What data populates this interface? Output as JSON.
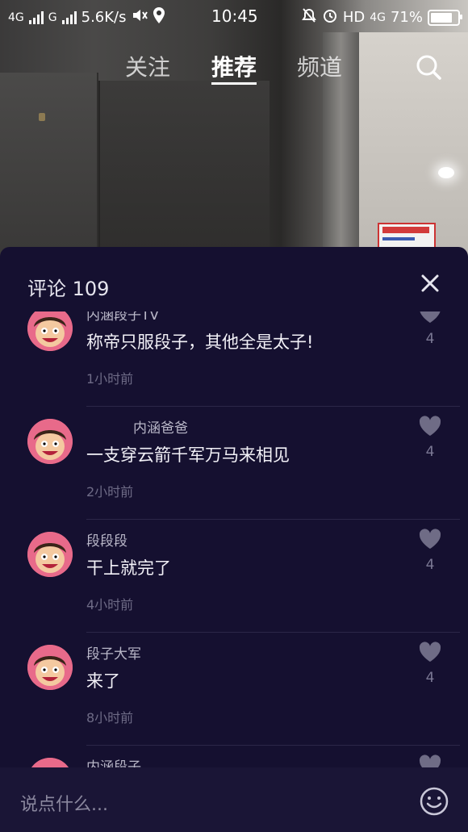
{
  "status_bar": {
    "net1": "4G",
    "net2": "G",
    "speed": "5.6K/s",
    "time": "10:45",
    "hd": "HD",
    "net3": "4G",
    "battery": "71%"
  },
  "nav": {
    "tabs": [
      "关注",
      "推荐",
      "频道"
    ],
    "active_tab": "推荐"
  },
  "comments_panel": {
    "title": "评论 109",
    "input_placeholder": "说点什么...",
    "comments": [
      {
        "user": "内涵段子TV",
        "text": "称帝只服段子，其他全是太子!",
        "time": "1小时前",
        "likes": "4"
      },
      {
        "user": "内涵爸爸",
        "text": "一支穿云箭千军万马来相见",
        "time": "2小时前",
        "likes": "4"
      },
      {
        "user": "段段段",
        "text": "干上就完了",
        "time": "4小时前",
        "likes": "4"
      },
      {
        "user": "段子大军",
        "text": "来了",
        "time": "8小时前",
        "likes": "4"
      },
      {
        "user": "内涵段子",
        "text": "",
        "time": "",
        "likes": ""
      }
    ]
  },
  "colors": {
    "panel_bg": "#151030",
    "avatar_bg": "#e86a8a"
  }
}
